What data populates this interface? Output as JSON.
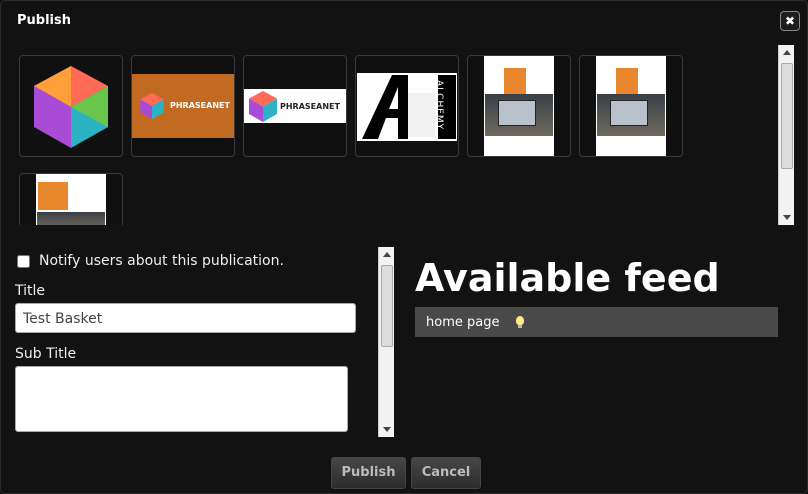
{
  "dialog": {
    "title": "Publish",
    "close_icon": "close-icon"
  },
  "thumbnails": [
    {
      "name": "cube-logo"
    },
    {
      "name": "phraseanet-orange",
      "text": "PHRASEANET"
    },
    {
      "name": "phraseanet-white",
      "text": "PHRASEANET"
    },
    {
      "name": "alchemy-logo",
      "text": "ALCHEMY"
    },
    {
      "name": "brochure-1"
    },
    {
      "name": "brochure-2"
    },
    {
      "name": "brochure-3"
    }
  ],
  "form": {
    "notify_label": "Notify users about this publication.",
    "title_label": "Title",
    "title_value": "Test Basket",
    "subtitle_label": "Sub Title",
    "subtitle_value": ""
  },
  "feed": {
    "heading": "Available feed",
    "items": [
      {
        "label": "home page",
        "icon": "lightbulb-icon"
      }
    ]
  },
  "buttons": {
    "publish": "Publish",
    "cancel": "Cancel"
  }
}
